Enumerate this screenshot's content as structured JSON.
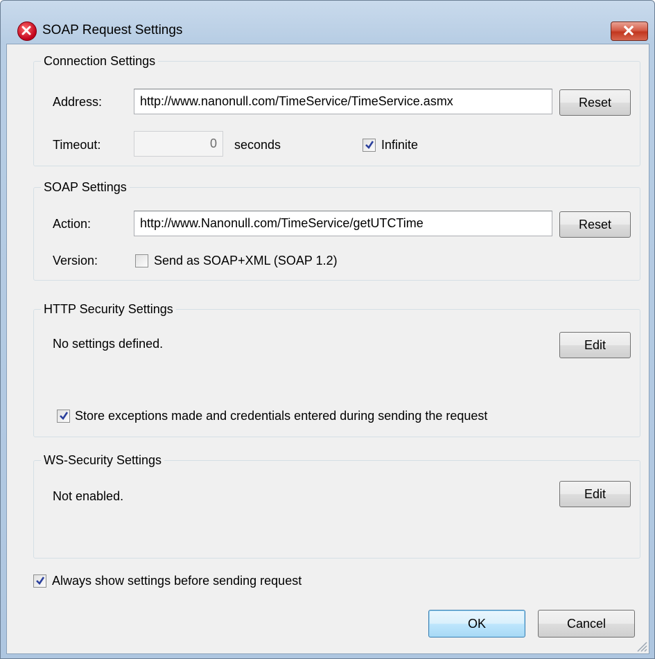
{
  "window": {
    "title": "SOAP Request Settings"
  },
  "connection": {
    "legend": "Connection Settings",
    "address_label": "Address:",
    "address_value": "http://www.nanonull.com/TimeService/TimeService.asmx",
    "reset_label": "Reset",
    "timeout_label": "Timeout:",
    "timeout_value": "0",
    "seconds_label": "seconds",
    "infinite_label": "Infinite",
    "infinite_checked": true
  },
  "soap": {
    "legend": "SOAP Settings",
    "action_label": "Action:",
    "action_value": "http://www.Nanonull.com/TimeService/getUTCTime",
    "reset_label": "Reset",
    "version_label": "Version:",
    "soap12_label": "Send as SOAP+XML (SOAP 1.2)",
    "soap12_checked": false
  },
  "http_security": {
    "legend": "HTTP Security Settings",
    "status": "No settings defined.",
    "edit_label": "Edit",
    "store_label": "Store exceptions made and credentials entered during sending the request",
    "store_checked": true
  },
  "ws_security": {
    "legend": "WS-Security Settings",
    "status": "Not enabled.",
    "edit_label": "Edit"
  },
  "always_show_label": "Always show settings before sending request",
  "always_show_checked": true,
  "buttons": {
    "ok": "OK",
    "cancel": "Cancel"
  }
}
